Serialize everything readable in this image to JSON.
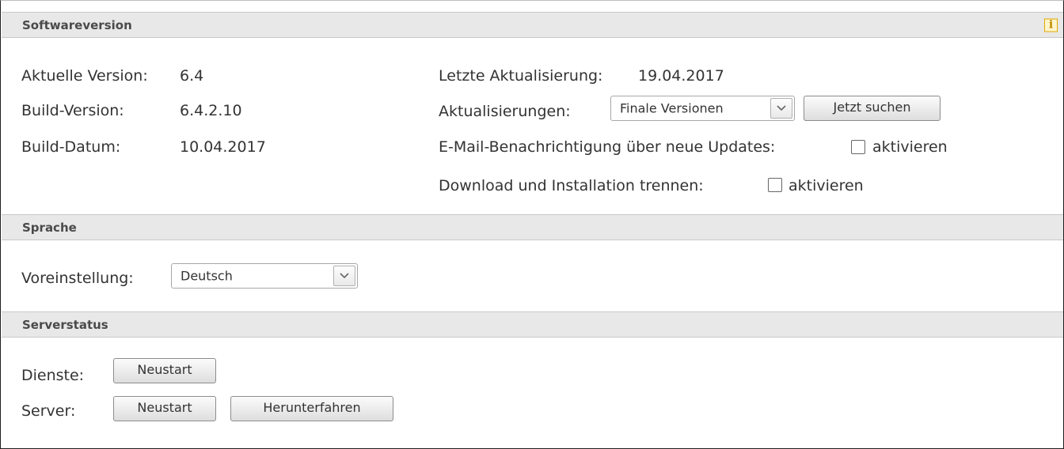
{
  "software": {
    "header": "Softwareversion",
    "current_version_label": "Aktuelle Version:",
    "current_version_value": "6.4",
    "build_version_label": "Build-Version:",
    "build_version_value": "6.4.2.10",
    "build_date_label": "Build-Datum:",
    "build_date_value": "10.04.2017",
    "last_update_label": "Letzte Aktualisierung:",
    "last_update_value": "19.04.2017",
    "updates_label": "Aktualisierungen:",
    "updates_selected": "Finale Versionen",
    "search_button": "Jetzt suchen",
    "email_notify_label": "E-Mail-Benachrichtigung über neue Updates:",
    "email_notify_checkbox_label": "aktivieren",
    "download_split_label": "Download und Installation trennen:",
    "download_split_checkbox_label": "aktivieren"
  },
  "language": {
    "header": "Sprache",
    "default_label": "Voreinstellung:",
    "default_selected": "Deutsch"
  },
  "server_status": {
    "header": "Serverstatus",
    "services_label": "Dienste:",
    "services_restart": "Neustart",
    "server_label": "Server:",
    "server_restart": "Neustart",
    "server_shutdown": "Herunterfahren"
  },
  "icons": {
    "info": "info-icon",
    "dropdown": "chevron-down-icon"
  },
  "colors": {
    "header_bg": "#e8e8e8",
    "info_accent": "#e0a800"
  }
}
